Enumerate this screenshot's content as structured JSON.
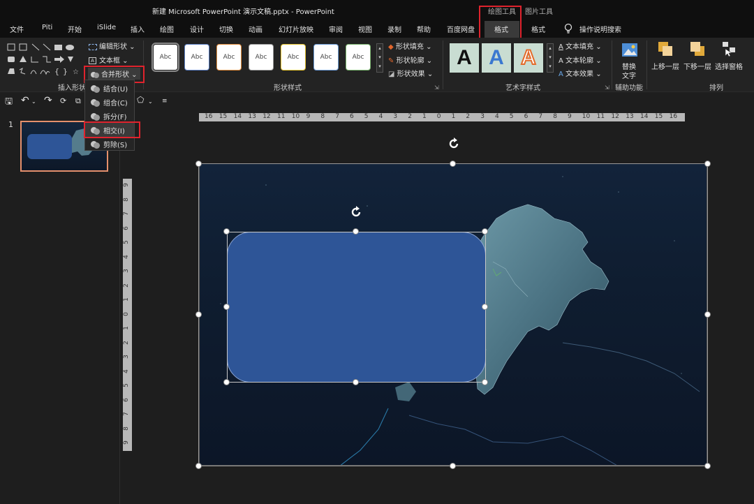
{
  "title": "新建 Microsoft PowerPoint 演示文稿.pptx  -  PowerPoint",
  "context_tabs": {
    "drawing_tools": "绘图工具",
    "picture_tools": "图片工具"
  },
  "tabs": [
    "文件",
    "Piti",
    "开始",
    "iSlide",
    "插入",
    "绘图",
    "设计",
    "切换",
    "动画",
    "幻灯片放映",
    "审阅",
    "视图",
    "录制",
    "帮助",
    "百度网盘",
    "格式",
    "格式"
  ],
  "search": {
    "label": "操作说明搜索"
  },
  "ribbon": {
    "insert_shapes": {
      "edit_shape": "编辑形状",
      "text_box": "文本框",
      "merge_shapes": "合并形状",
      "label": "插入形状"
    },
    "shape_styles": {
      "samples": [
        "Abc",
        "Abc",
        "Abc",
        "Abc",
        "Abc",
        "Abc",
        "Abc"
      ],
      "fill": "形状填充",
      "outline": "形状轮廓",
      "effects": "形状效果",
      "label": "形状样式"
    },
    "wordart": {
      "letter": "A",
      "text_fill": "文本填充",
      "text_outline": "文本轮廓",
      "text_effects": "文本效果",
      "label": "艺术字样式"
    },
    "accessibility": {
      "alt_text_1": "替换",
      "alt_text_2": "文字",
      "label": "辅助功能"
    },
    "arrange": {
      "bring_forward": "上移一层",
      "send_backward": "下移一层",
      "selection_pane": "选择窗格",
      "label": "排列"
    }
  },
  "merge_menu": {
    "items": [
      "结合(U)",
      "组合(C)",
      "拆分(F)",
      "相交(I)",
      "剪除(S)"
    ]
  },
  "slide_panel": {
    "number": "1"
  },
  "ruler": {
    "h": [
      "16",
      "15",
      "14",
      "13",
      "12",
      "11",
      "10",
      "9",
      "8",
      "7",
      "6",
      "5",
      "4",
      "3",
      "2",
      "1",
      "0",
      "1",
      "2",
      "3",
      "4",
      "5",
      "6",
      "7",
      "8",
      "9",
      "10",
      "11",
      "12",
      "13",
      "14",
      "15",
      "16"
    ],
    "v": [
      "9",
      "8",
      "7",
      "6",
      "5",
      "4",
      "3",
      "2",
      "1",
      "0",
      "1",
      "2",
      "3",
      "4",
      "5",
      "6",
      "7",
      "8",
      "9"
    ]
  },
  "colors": {
    "accent_red": "#e0232d",
    "shape_blue": "#2e5597",
    "ribbon_bg": "#232323"
  }
}
